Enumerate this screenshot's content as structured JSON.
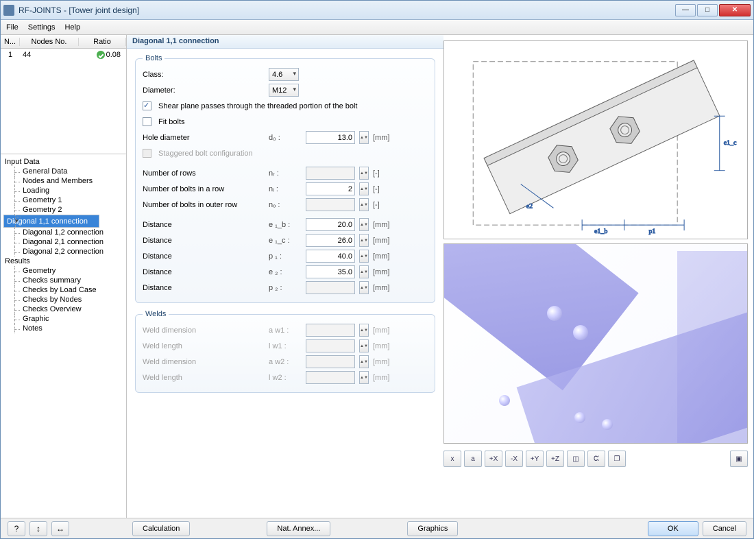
{
  "window": {
    "title": "RF-JOINTS - [Tower joint design]"
  },
  "menu": {
    "file": "File",
    "settings": "Settings",
    "help": "Help"
  },
  "grid": {
    "cols": {
      "n": "N...",
      "nodes": "Nodes No.",
      "ratio": "Ratio"
    },
    "row": {
      "n": "1",
      "nodes": "44",
      "ratio": "0.08"
    }
  },
  "tree": {
    "input": "Input Data",
    "general": "General Data",
    "nodes": "Nodes and Members",
    "loading": "Loading",
    "geo1": "Geometry 1",
    "geo2": "Geometry 2",
    "d11": "Diagonal 1,1 connection",
    "d12": "Diagonal 1,2 connection",
    "d21": "Diagonal 2,1 connection",
    "d22": "Diagonal 2,2 connection",
    "results": "Results",
    "r_geo": "Geometry",
    "r_sum": "Checks summary",
    "r_lc": "Checks by Load Case",
    "r_nodes": "Checks by Nodes",
    "r_ov": "Checks Overview",
    "r_gfx": "Graphic",
    "r_notes": "Notes"
  },
  "panel": {
    "title": "Diagonal 1,1 connection"
  },
  "bolts": {
    "legend": "Bolts",
    "class_lbl": "Class:",
    "class_val": "4.6",
    "dia_lbl": "Diameter:",
    "dia_val": "M12",
    "shear_lbl": "Shear plane passes through the threaded portion of the bolt",
    "fit_lbl": "Fit bolts",
    "hole_lbl": "Hole diameter",
    "hole_sym": "d₀ :",
    "hole_val": "13.0",
    "stag_lbl": "Staggered bolt configuration",
    "nrows_lbl": "Number of rows",
    "nrows_sym": "nᵣ :",
    "ni_lbl": "Number of bolts in a row",
    "ni_sym": "nᵢ :",
    "ni_val": "2",
    "no_lbl": "Number of bolts in outer row",
    "no_sym": "nₒ :",
    "e1b_lbl": "Distance",
    "e1b_sym": "e ₁_b :",
    "e1b_val": "20.0",
    "e1c_lbl": "Distance",
    "e1c_sym": "e ₁_c :",
    "e1c_val": "26.0",
    "p1_lbl": "Distance",
    "p1_sym": "p ₁ :",
    "p1_val": "40.0",
    "e2_lbl": "Distance",
    "e2_sym": "e ₂ :",
    "e2_val": "35.0",
    "p2_lbl": "Distance",
    "p2_sym": "p ₂ :",
    "mm": "[mm]",
    "dash": "[-]"
  },
  "welds": {
    "legend": "Welds",
    "wd1_lbl": "Weld dimension",
    "wd1_sym": "a w1 :",
    "wl1_lbl": "Weld length",
    "wl1_sym": "l w1 :",
    "wd2_lbl": "Weld dimension",
    "wd2_sym": "a w2 :",
    "wl2_lbl": "Weld length",
    "wl2_sym": "l w2 :"
  },
  "schem": {
    "e1b": "e1_b",
    "p1": "p1",
    "e1c": "e1_c",
    "e2": "e2"
  },
  "tb": {
    "x": "x",
    "a": "a",
    "px": "+X",
    "mx": "-X",
    "py": "+Y",
    "pz": "+Z",
    "cube": "◫",
    "ck": "ᙅ",
    "cp": "❐",
    "exp": "▣"
  },
  "bottom": {
    "help": "?",
    "collapse": "↕",
    "expand": "↔",
    "calc": "Calculation",
    "nat": "Nat. Annex...",
    "gfx": "Graphics",
    "ok": "OK",
    "cancel": "Cancel"
  }
}
